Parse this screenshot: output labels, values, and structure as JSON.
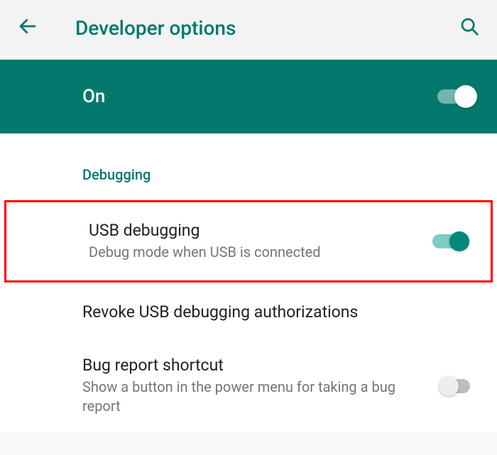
{
  "header": {
    "title": "Developer options"
  },
  "master": {
    "label": "On",
    "on": true
  },
  "section": {
    "debugging_header": "Debugging"
  },
  "items": {
    "usb_debugging": {
      "title": "USB debugging",
      "subtitle": "Debug mode when USB is connected",
      "on": true
    },
    "revoke": {
      "title": "Revoke USB debugging authorizations"
    },
    "bug_report": {
      "title": "Bug report shortcut",
      "subtitle": "Show a button in the power menu for taking a bug report",
      "on": false
    }
  },
  "colors": {
    "accent": "#00796b",
    "highlight": "#ff0000"
  }
}
